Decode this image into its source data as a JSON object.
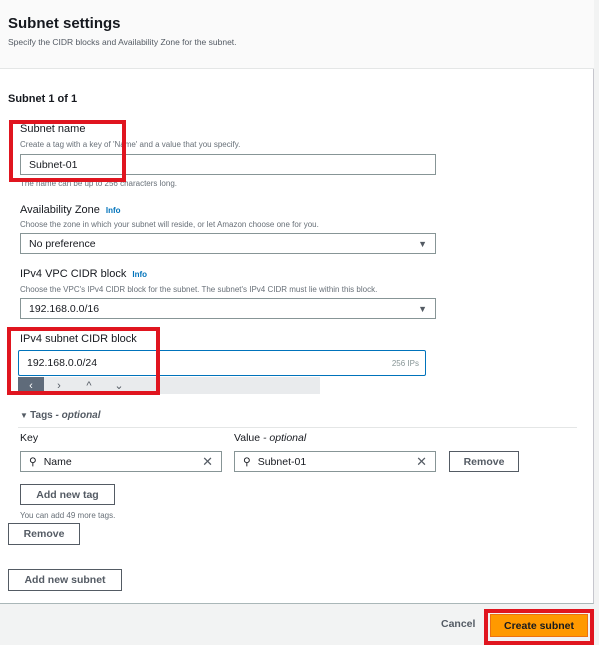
{
  "header": {
    "title": "Subnet settings",
    "description": "Specify the CIDR blocks and Availability Zone for the subnet."
  },
  "subnet_counter": "Subnet 1 of 1",
  "subnet_name": {
    "label": "Subnet name",
    "help": "Create a tag with a key of 'Name' and a value that you specify.",
    "value": "Subnet-01",
    "hint": "The name can be up to 256 characters long."
  },
  "availability_zone": {
    "label": "Availability Zone",
    "info": "Info",
    "help": "Choose the zone in which your subnet will reside, or let Amazon choose one for you.",
    "value": "No preference"
  },
  "vpc_cidr": {
    "label": "IPv4 VPC CIDR block",
    "info": "Info",
    "help": "Choose the VPC's IPv4 CIDR block for the subnet. The subnet's IPv4 CIDR must lie within this block.",
    "value": "192.168.0.0/16"
  },
  "subnet_cidr": {
    "label": "IPv4 subnet CIDR block",
    "value": "192.168.0.0/24",
    "ip_count": "256 IPs",
    "nav": [
      "‹",
      "›",
      "^",
      "⌄"
    ]
  },
  "tags": {
    "title": "Tags",
    "optional": "- optional",
    "key_label": "Key",
    "value_label": "Value",
    "value_optional": "- optional",
    "key": "Name",
    "value": "Subnet-01",
    "remove": "Remove",
    "add": "Add new tag",
    "limit": "You can add 49 more tags."
  },
  "remove_subnet": "Remove",
  "add_subnet": "Add new subnet",
  "footer": {
    "cancel": "Cancel",
    "create": "Create subnet"
  },
  "colors": {
    "primary": "#ff9900",
    "highlight": "#e0151f",
    "link": "#0073bb"
  }
}
